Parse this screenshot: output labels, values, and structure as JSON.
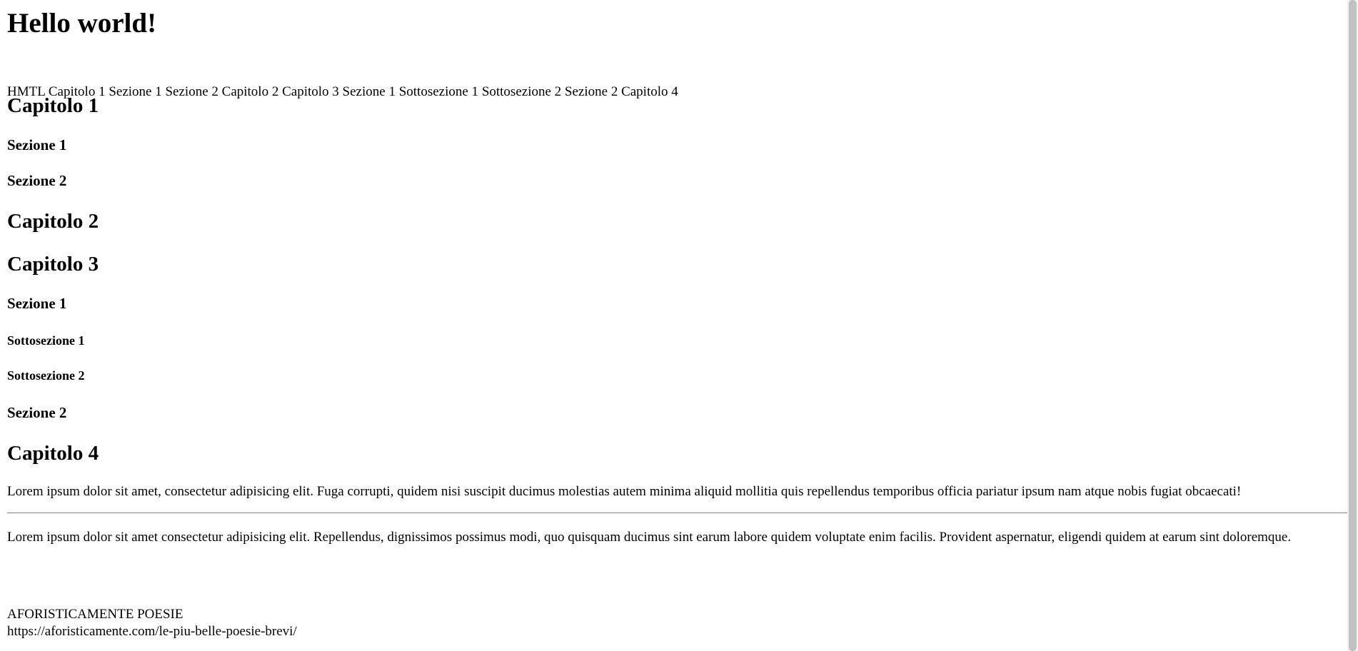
{
  "hero_title": "Hello world!",
  "nav": [
    "HMTL",
    "Capitolo 1",
    "Sezione 1",
    "Sezione 2",
    "Capitolo 2",
    "Capitolo 3",
    "Sezione 1",
    "Sottosezione 1",
    "Sottosezione 2",
    "Sezione 2",
    "Capitolo 4"
  ],
  "headings": {
    "cap1": "Capitolo 1",
    "cap1_sez1": "Sezione 1",
    "cap1_sez2": "Sezione 2",
    "cap2": "Capitolo 2",
    "cap3": "Capitolo 3",
    "cap3_sez1": "Sezione 1",
    "cap3_sub1": "Sottosezione 1",
    "cap3_sub2": "Sottosezione 2",
    "cap3_sez2": "Sezione 2",
    "cap4": "Capitolo 4"
  },
  "paragraphs": {
    "p1": "Lorem ipsum dolor sit amet, consectetur adipisicing elit. Fuga corrupti, quidem nisi suscipit ducimus molestias autem minima aliquid mollitia quis repellendus temporibus officia pariatur ipsum nam atque nobis fugiat obcaecati!",
    "p2": "Lorem ipsum dolor sit amet consectetur adipisicing elit. Repellendus, dignissimos possimus modi, quo quisquam ducimus sint earum labore quidem voluptate enim facilis. Provident aspernatur, eligendi quidem at earum sint doloremque."
  },
  "footer": {
    "title": "AFORISTICAMENTE POESIE",
    "url": "https://aforisticamente.com/le-piu-belle-poesie-brevi/"
  }
}
